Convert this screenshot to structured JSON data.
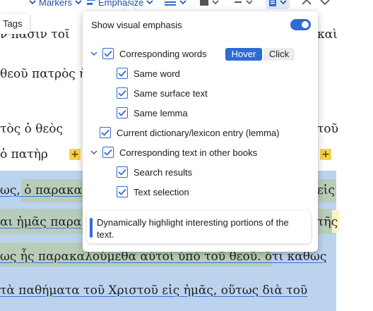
{
  "toolbar": {
    "markers_label": "Markers",
    "emphasize_label": "Emphasize",
    "tags_label": "Tags"
  },
  "document": {
    "lines": [
      "ν πᾶσιν τοῖ",
      "θεοῦ πατρὸς ἡ",
      "τὸς ὁ θεὸς",
      "ὁ πατὴρ",
      "ως, ὁ παρακα",
      "αι ἡμᾶς παρα",
      "ως ἧς παρακαλούμεθα αὐτοὶ ὑπὸ τοῦ θεοῦ. ὅτι καθὼς",
      "τὰ παθήματα τοῦ Χριστοῦ εἰς ἡμᾶς, οὕτως διὰ τοῦ"
    ],
    "right_fragments": [
      "καὶ",
      "τοῦ",
      "εἰς",
      "τῆς"
    ]
  },
  "popup": {
    "show_emphasis_label": "Show visual emphasis",
    "show_emphasis_on": true,
    "corresponding_words_label": "Corresponding words",
    "mode_hover_label": "Hover",
    "mode_click_label": "Click",
    "same_word_label": "Same word",
    "same_surface_label": "Same surface text",
    "same_lemma_label": "Same lemma",
    "lexicon_label": "Current dictionary/lexicon entry (lemma)",
    "other_books_label": "Corresponding text in other books",
    "search_results_label": "Search results",
    "text_selection_label": "Text selection",
    "info_text": "Dynamically highlight interesting portions of the text."
  },
  "colors": {
    "accent": "#2f6bd4",
    "highlight_blue": "#bcd3ee",
    "highlight_green": "#b8cdb9",
    "marker_yellow": "#f5d24a"
  }
}
